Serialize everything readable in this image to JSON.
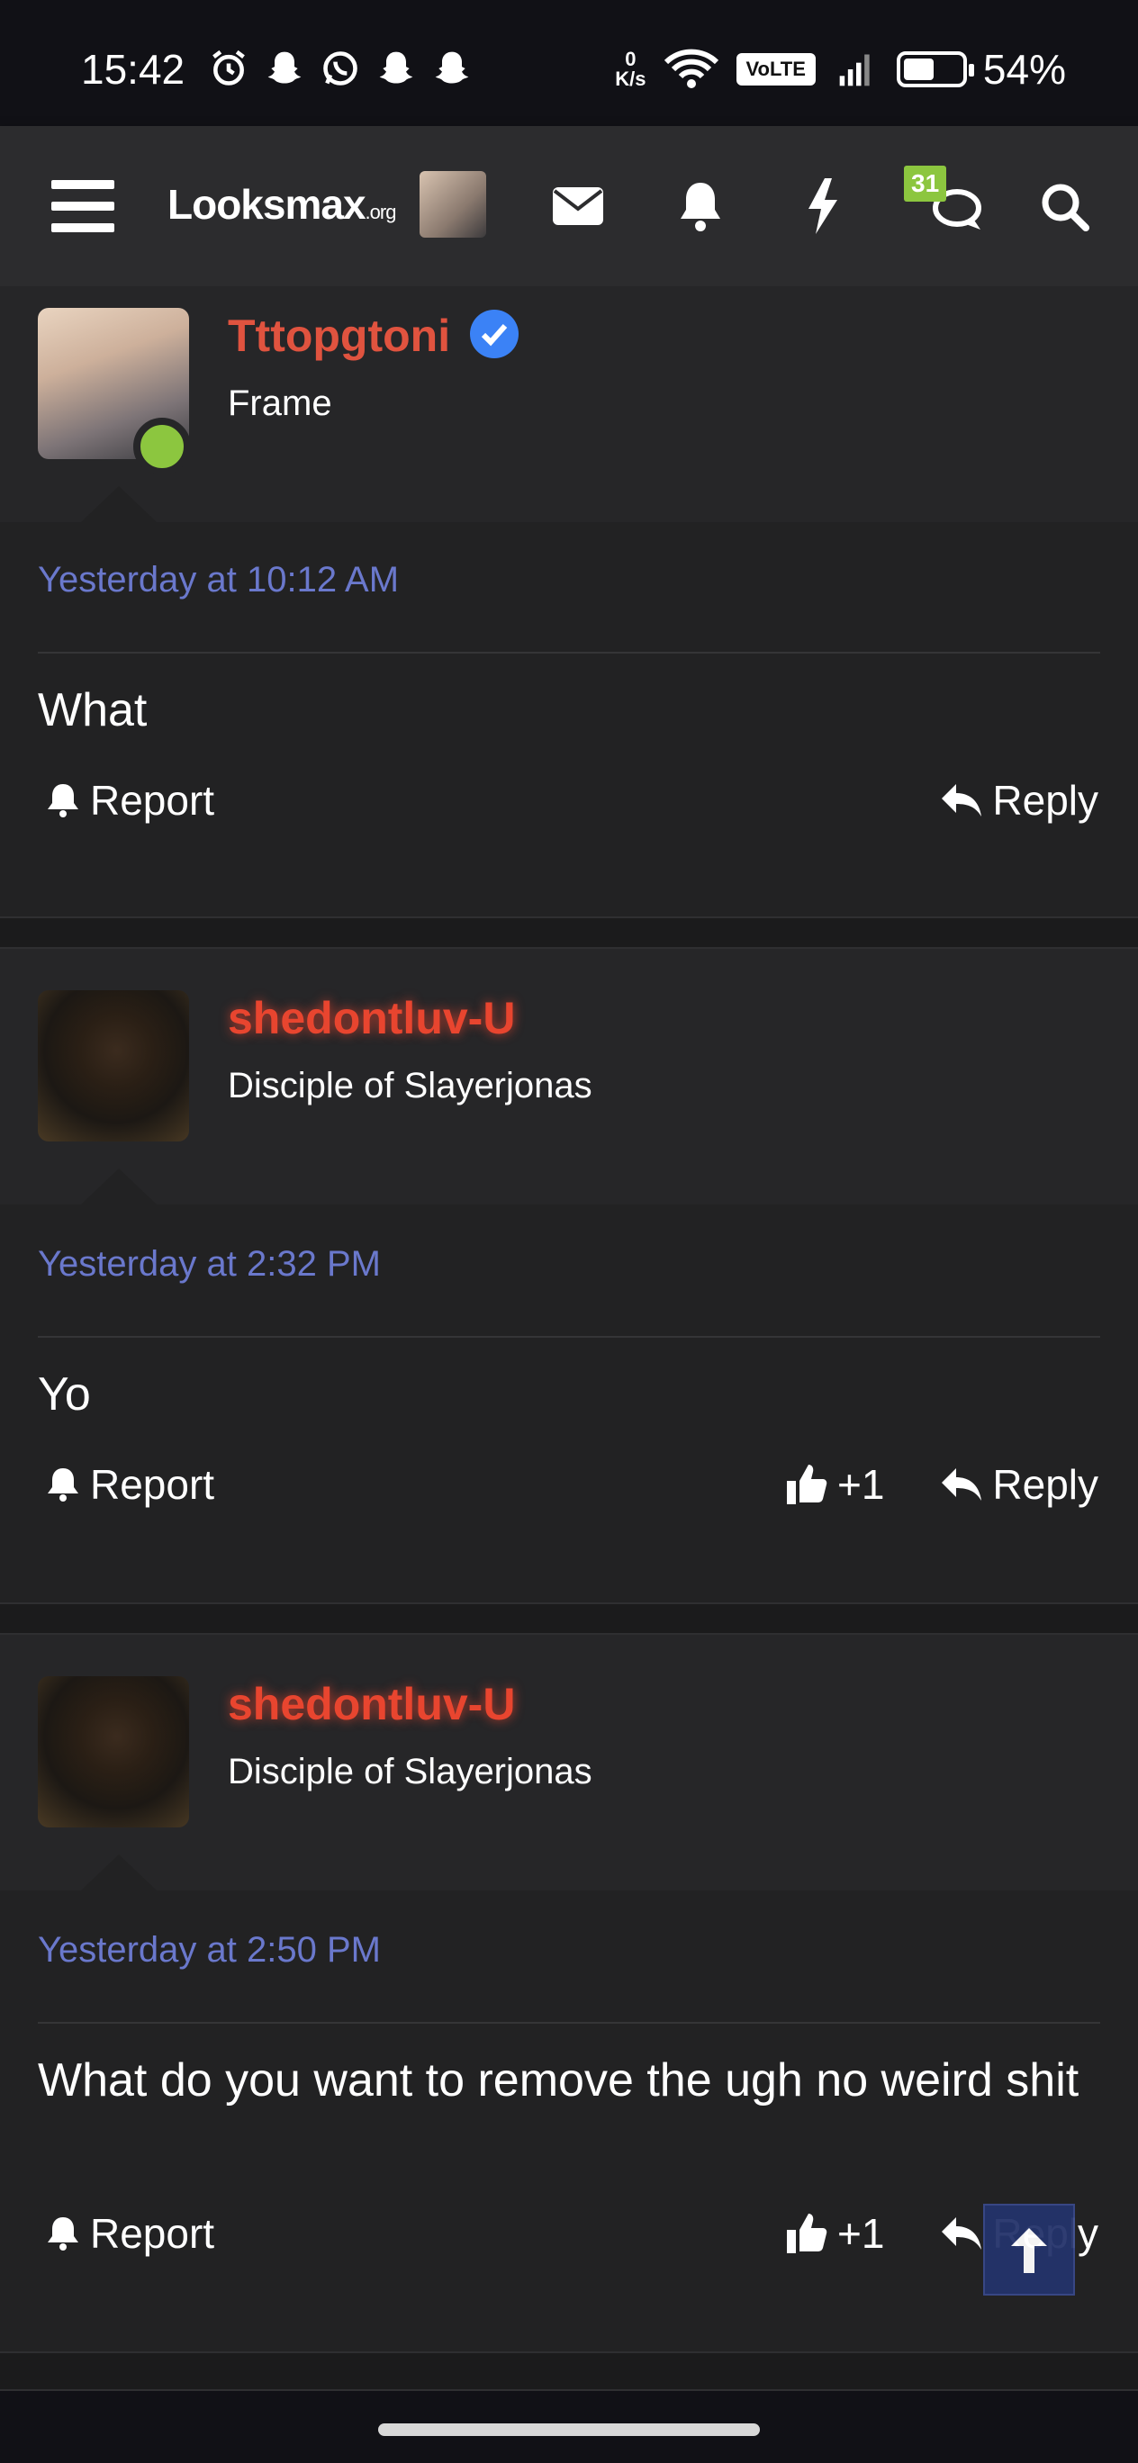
{
  "status_bar": {
    "time": "15:42",
    "net_speed_value": "0",
    "net_speed_unit": "K/s",
    "volte": "VoLTE",
    "battery": "54%",
    "battery_level": 0.54
  },
  "header": {
    "logo_main": "Looksmax",
    "logo_suffix": ".org",
    "chat_badge": "31"
  },
  "posts": [
    {
      "username": "Tttopgtoni",
      "user_title": "Frame",
      "date": "Yesterday at 10:12 AM",
      "message": "What",
      "report_label": "Report",
      "reply_label": "Reply"
    },
    {
      "username": "shedontluv-U",
      "user_title": "Disciple of Slayerjonas",
      "date": "Yesterday at 2:32 PM",
      "message": "Yo",
      "report_label": "Report",
      "like_label": "+1",
      "reply_label": "Reply"
    },
    {
      "username": "shedontluv-U",
      "user_title": "Disciple of Slayerjonas",
      "date": "Yesterday at 2:50 PM",
      "message": "What do you want to remove the ugh no weird shit",
      "report_label": "Report",
      "like_label": "+1",
      "reply_label": "Reply"
    }
  ],
  "colors": {
    "username_red": "#e0533f",
    "date_blue": "#6a78cc",
    "online_green": "#8cc63f",
    "verified_blue": "#3b82f6",
    "background": "#222223"
  }
}
